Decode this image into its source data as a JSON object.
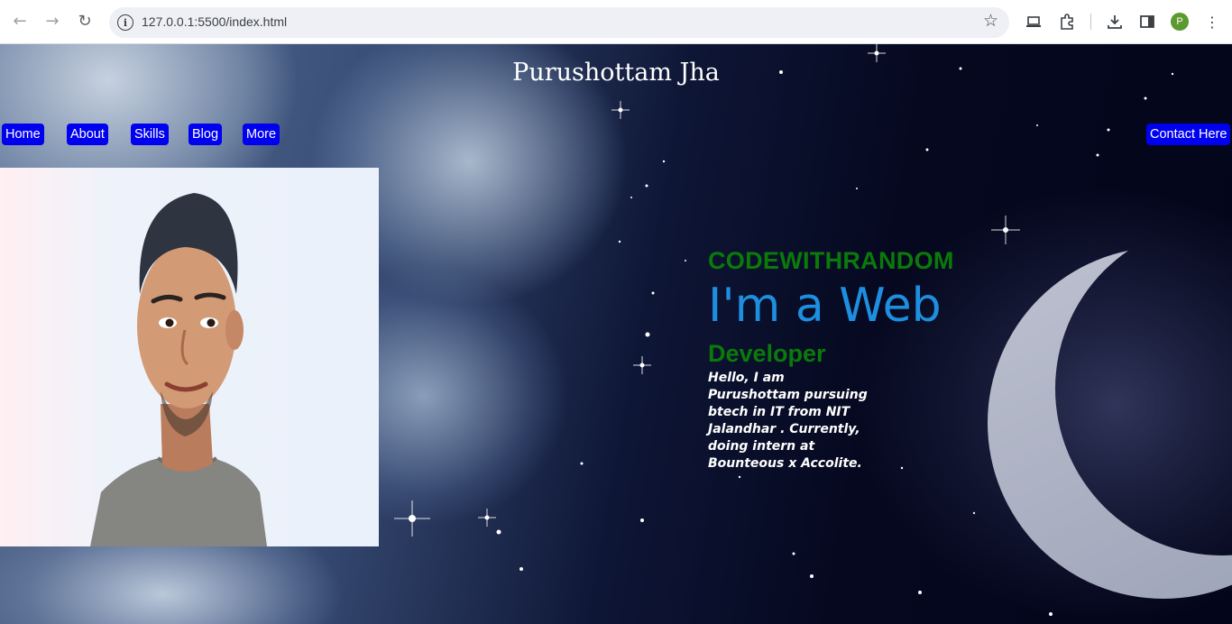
{
  "browser": {
    "url": "127.0.0.1:5500/index.html",
    "profile_initial": "P",
    "icons": [
      "back-arrow-icon",
      "forward-arrow-icon",
      "reload-icon",
      "site-info-icon",
      "bookmark-star-icon",
      "cast-icon",
      "extensions-icon",
      "download-icon",
      "side-panel-icon",
      "menu-dots-icon"
    ]
  },
  "site": {
    "title": "Purushottam Jha",
    "nav": [
      "Home",
      "About",
      "Skills",
      "Blog",
      "More"
    ],
    "contact_label": "Contact Here"
  },
  "hero": {
    "brand": "CODEWITHRANDOM",
    "headline": "I'm a Web",
    "role": "Developer",
    "intro": "Hello, I am Purushottam pursuing btech in IT from NIT Jalandhar . Currently, doing intern at Bounteous x Accolite."
  },
  "colors": {
    "nav_button_bg": "#0000f0",
    "brand_green": "#0a7a0a",
    "headline_blue": "#1e8fe0",
    "night_sky": "#05081f"
  }
}
